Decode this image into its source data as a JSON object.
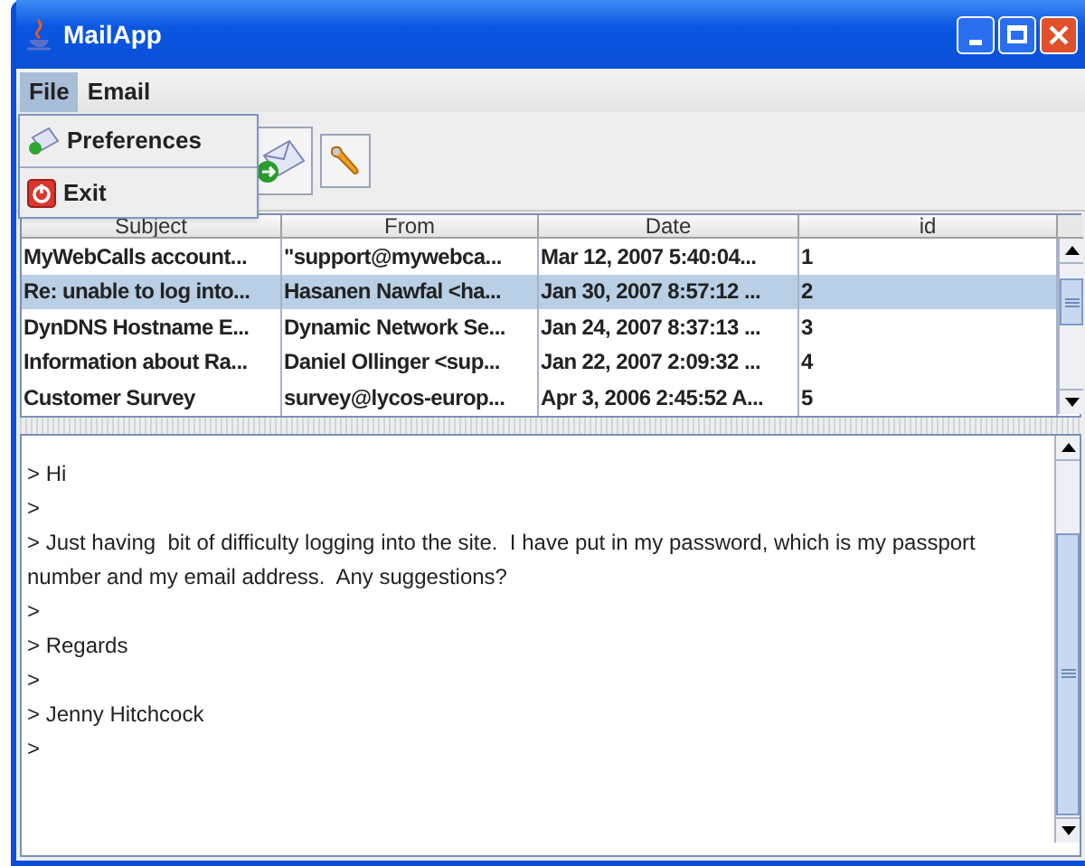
{
  "window": {
    "title": "MailApp"
  },
  "menu": [
    {
      "label": "File",
      "selected": true
    },
    {
      "label": "Email",
      "selected": false
    }
  ],
  "open_menu": [
    {
      "label": "Preferences",
      "kind": "preferences"
    },
    {
      "label": "Exit",
      "kind": "exit"
    }
  ],
  "table": {
    "columns": [
      "Subject",
      "From",
      "Date",
      "id"
    ],
    "rows": [
      {
        "cells": [
          "MyWebCalls account...",
          "\"support@mywebca...",
          "Mar 12, 2007 5:40:04...",
          "1"
        ],
        "selected": false
      },
      {
        "cells": [
          "Re: unable to log into...",
          "Hasanen Nawfal <ha...",
          "Jan 30, 2007 8:57:12 ...",
          "2"
        ],
        "selected": true
      },
      {
        "cells": [
          "DynDNS Hostname E...",
          "Dynamic Network Se...",
          "Jan 24, 2007 8:37:13 ...",
          "3"
        ],
        "selected": false
      },
      {
        "cells": [
          "Information about Ra...",
          "Daniel Ollinger <sup...",
          "Jan 22, 2007 2:09:32 ...",
          "4"
        ],
        "selected": false
      },
      {
        "cells": [
          "Customer Survey",
          "survey@lycos-europ...",
          "Apr 3, 2006 2:45:52 A...",
          "5"
        ],
        "selected": false
      }
    ]
  },
  "message": {
    "lines": [
      "> Hi",
      ">",
      "> Just having  bit of difficulty logging into the site.  I have put in my password, which is my passport number and my email address.  Any suggestions?",
      ">",
      "> Regards",
      ">",
      "> Jenny Hitchcock",
      ">"
    ]
  }
}
